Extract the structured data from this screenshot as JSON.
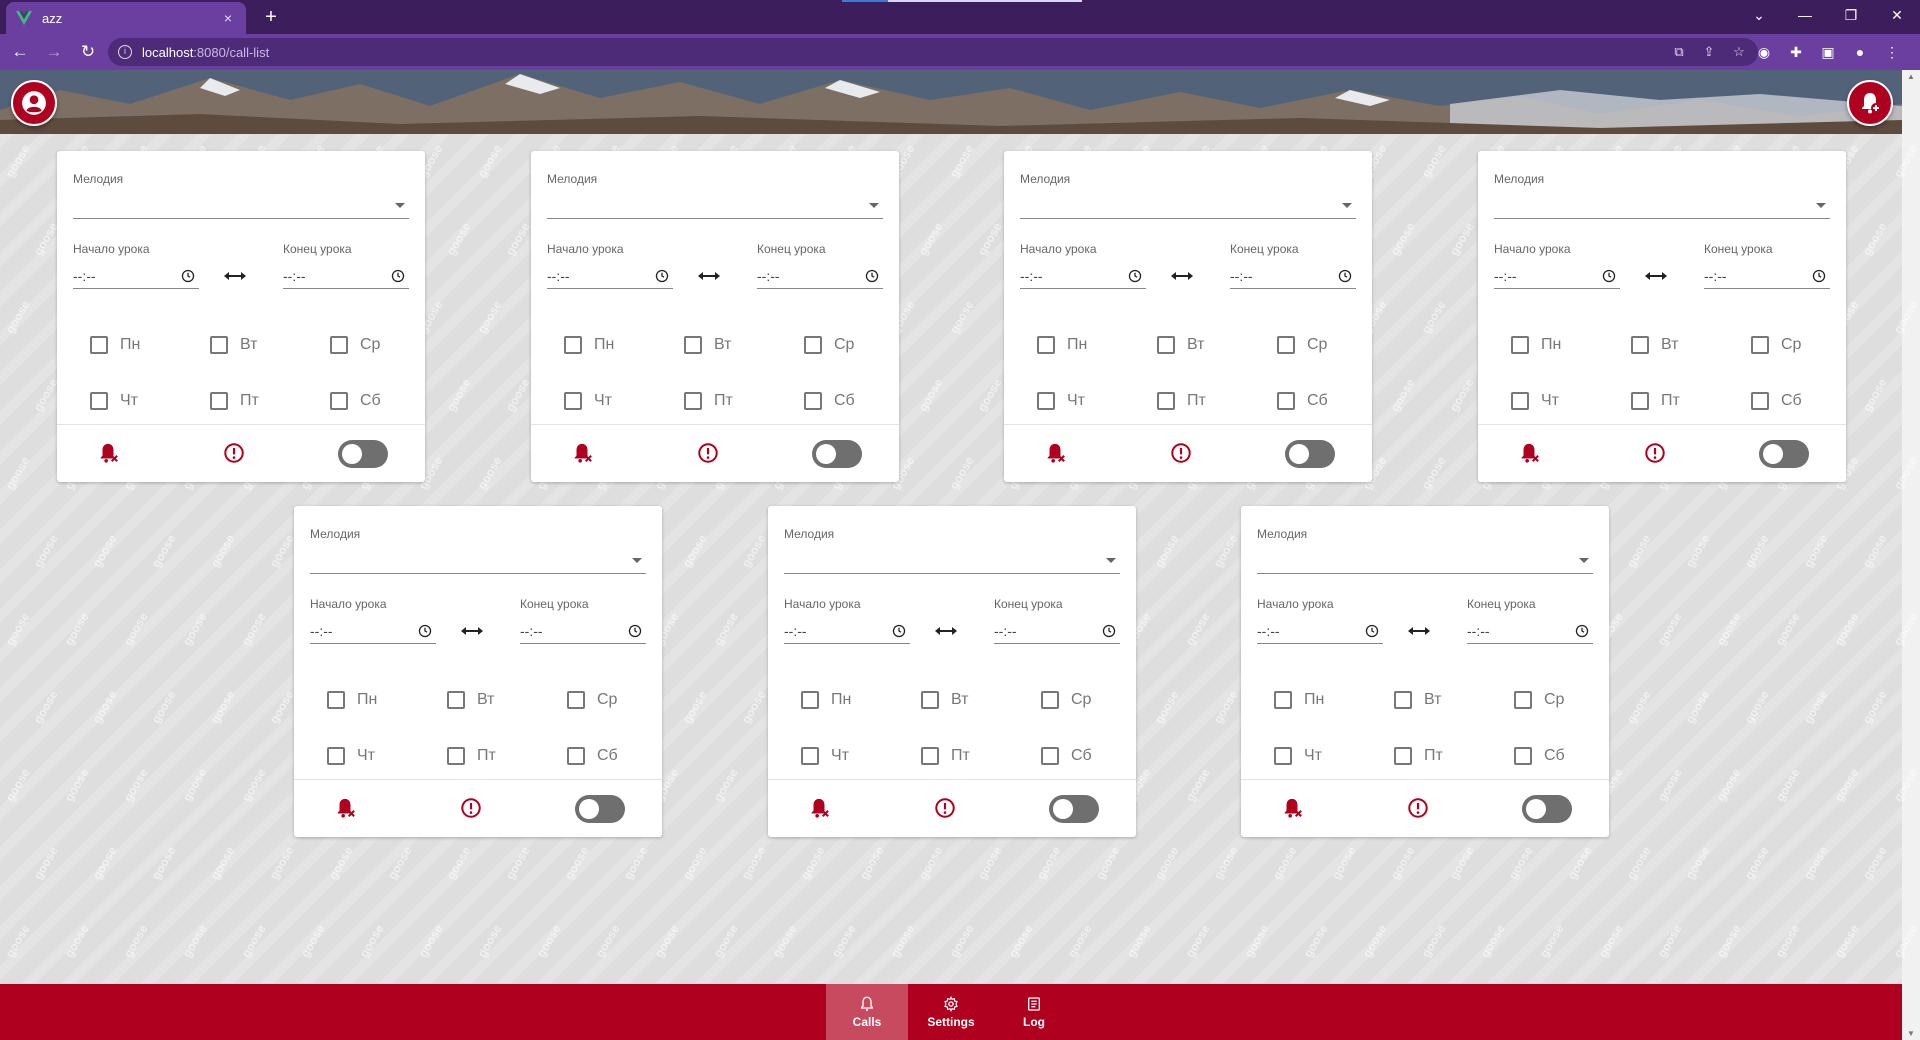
{
  "browser": {
    "tab_title": "azz",
    "new_tab": "+",
    "close_tab": "×",
    "url_host": "localhost",
    "url_path": ":8080/call-list"
  },
  "card": {
    "melody_label": "Мелодия",
    "start_label": "Начало урока",
    "end_label": "Конец урока",
    "start_value": "--:--",
    "end_value": "--:--",
    "days": [
      "Пн",
      "Вт",
      "Ср",
      "Чт",
      "Пт",
      "Сб"
    ]
  },
  "watermark": "goose",
  "nav": {
    "calls": "Calls",
    "settings": "Settings",
    "log": "Log"
  },
  "colors": {
    "brand": "#b0001f",
    "browser": "#6a3fa0",
    "toggle_off": "#6f6f6f"
  },
  "icons": {
    "calls": "bell-icon",
    "settings": "gear-icon",
    "log": "document-icon",
    "profile": "user-circle-icon",
    "add_call": "bell-plus-icon",
    "mute": "bell-off-icon",
    "alert": "alert-circle-icon"
  }
}
